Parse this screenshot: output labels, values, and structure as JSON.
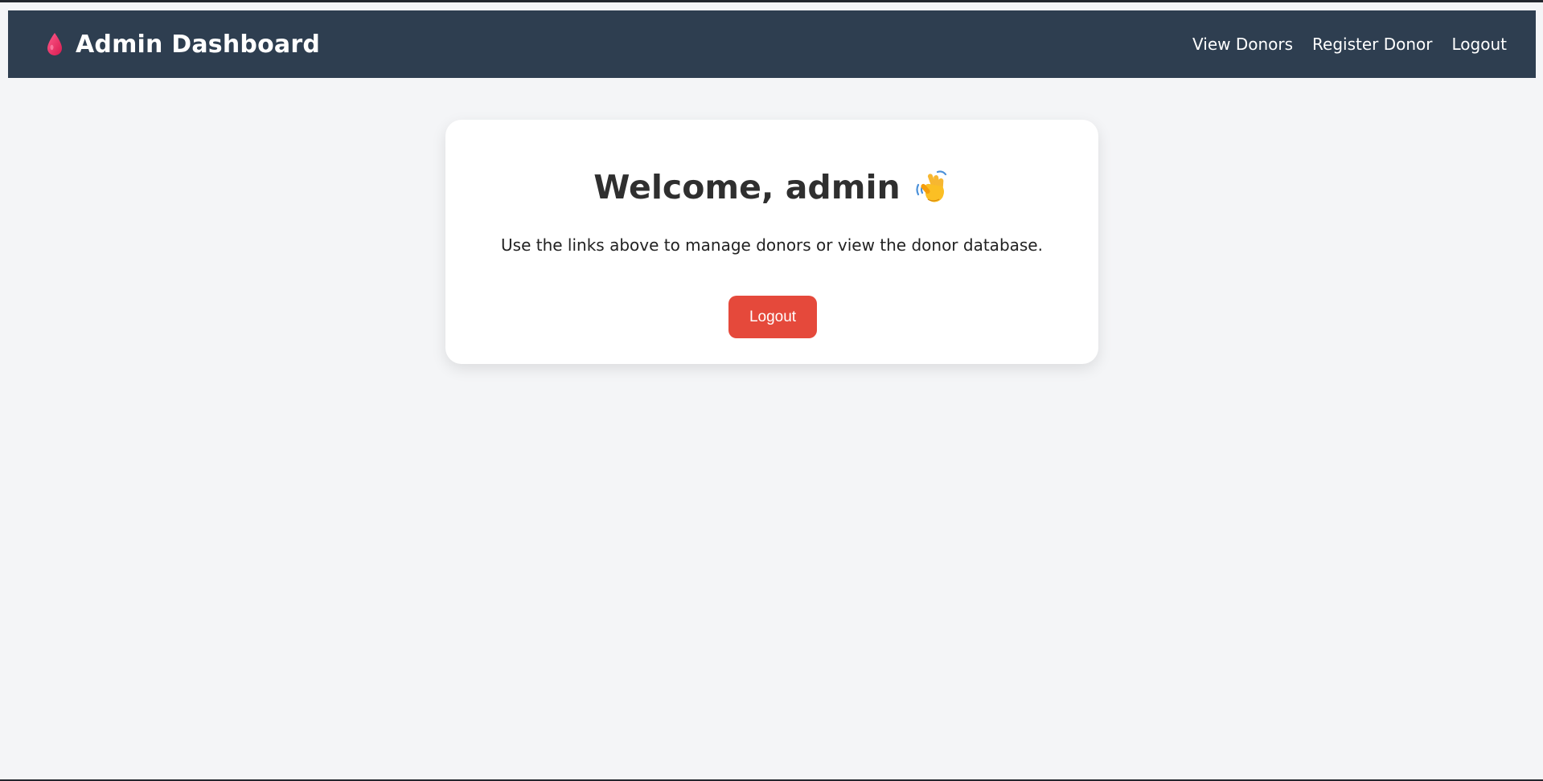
{
  "navbar": {
    "title": "Admin Dashboard",
    "brand_icon": "blood-drop-icon",
    "links": [
      {
        "label": "View Donors"
      },
      {
        "label": "Register Donor"
      },
      {
        "label": "Logout"
      }
    ]
  },
  "main": {
    "welcome_title": "Welcome, admin",
    "welcome_icon": "waving-hand-icon",
    "subtitle": "Use the links above to manage donors or view the donor database.",
    "logout_label": "Logout"
  },
  "colors": {
    "navbar_bg": "#2e3e50",
    "page_bg": "#f4f5f7",
    "accent_drop": "#e8245f",
    "logout_button": "#e5493b"
  }
}
